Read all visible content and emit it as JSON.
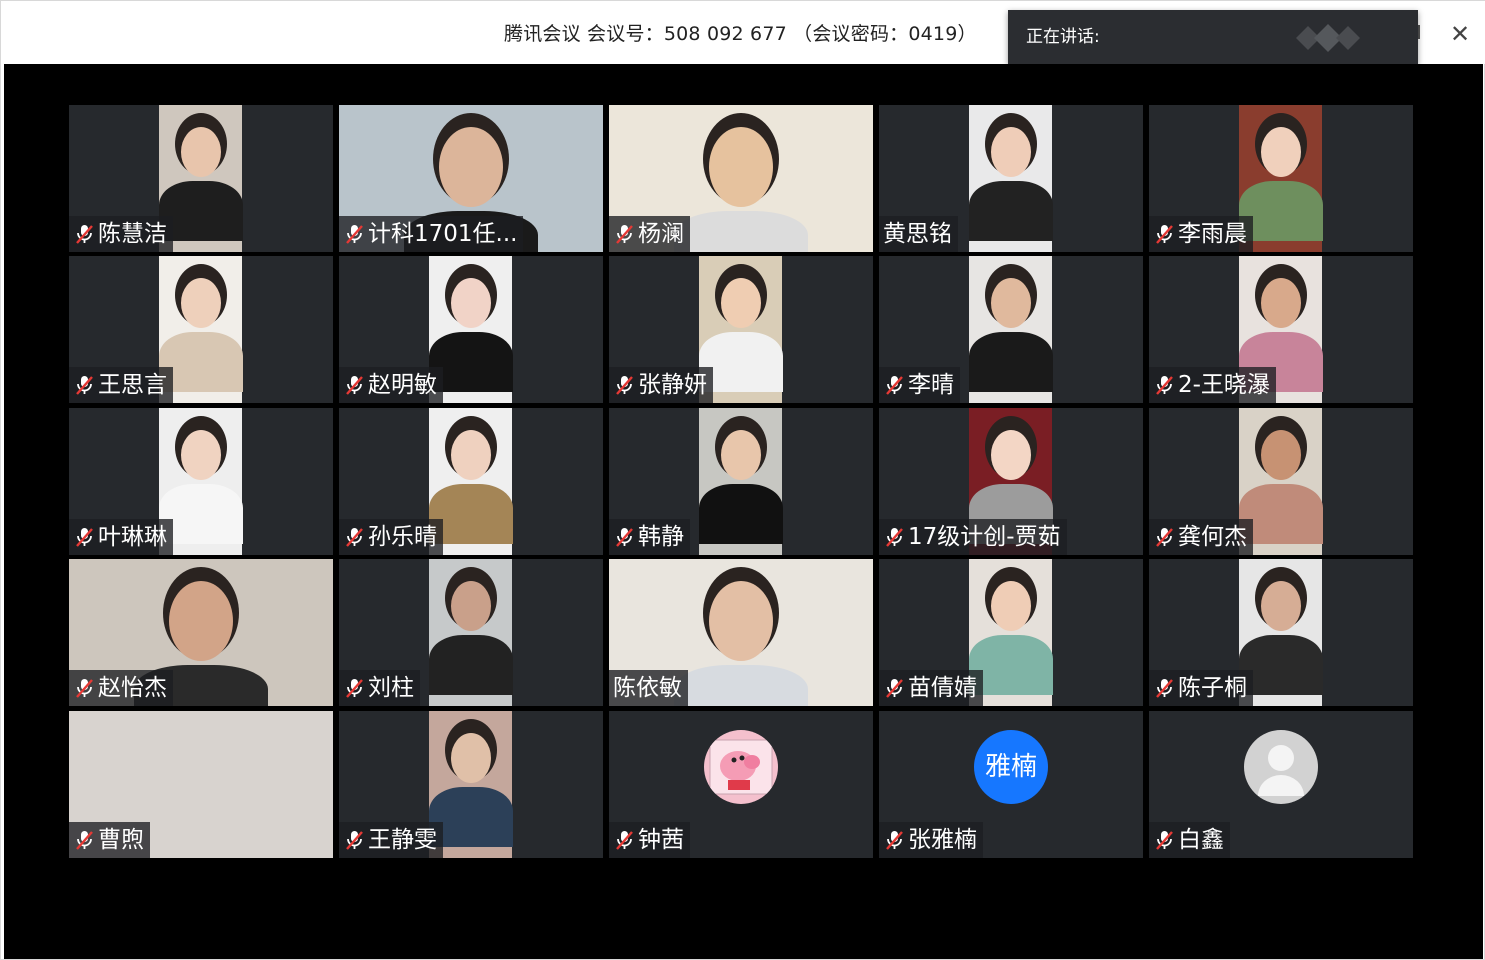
{
  "window": {
    "title": "腾讯会议  会议号：508 092 677 （会议密码：0419）",
    "close_icon": "close-icon",
    "maximize_icon": "maximize-icon"
  },
  "speaking_panel": {
    "label": "正在讲话:",
    "logo_icon": "tencent-meeting-logo-icon"
  },
  "colors": {
    "stage_bg": "#000000",
    "tile_bg": "#26292d",
    "avatar_blue": "#1677ff",
    "mic_muted_red": "#e53935"
  },
  "participants": [
    {
      "name": "陈慧洁",
      "muted": true,
      "tile": "video"
    },
    {
      "name": "计科1701任...",
      "muted": true,
      "tile": "video"
    },
    {
      "name": "杨澜",
      "muted": true,
      "tile": "video"
    },
    {
      "name": "黄思铭",
      "muted": false,
      "tile": "video"
    },
    {
      "name": "李雨晨",
      "muted": true,
      "tile": "video"
    },
    {
      "name": "王思言",
      "muted": true,
      "tile": "video"
    },
    {
      "name": "赵明敏",
      "muted": true,
      "tile": "video"
    },
    {
      "name": "张静妍",
      "muted": true,
      "tile": "video"
    },
    {
      "name": "李晴",
      "muted": true,
      "tile": "video"
    },
    {
      "name": "2-王晓瀑",
      "muted": true,
      "tile": "video"
    },
    {
      "name": "叶琳琳",
      "muted": true,
      "tile": "video"
    },
    {
      "name": "孙乐晴",
      "muted": true,
      "tile": "video"
    },
    {
      "name": "韩静",
      "muted": true,
      "tile": "video"
    },
    {
      "name": "17级计创-贾茹",
      "muted": true,
      "tile": "video"
    },
    {
      "name": "龚何杰",
      "muted": true,
      "tile": "video"
    },
    {
      "name": "赵怡杰",
      "muted": true,
      "tile": "video"
    },
    {
      "name": "刘柱",
      "muted": true,
      "tile": "video"
    },
    {
      "name": "陈依敏",
      "muted": false,
      "tile": "video"
    },
    {
      "name": "苗倩婧",
      "muted": true,
      "tile": "video"
    },
    {
      "name": "陈子桐",
      "muted": true,
      "tile": "video"
    },
    {
      "name": "曹煦",
      "muted": true,
      "tile": "video"
    },
    {
      "name": "王静雯",
      "muted": true,
      "tile": "video"
    },
    {
      "name": "钟茜",
      "muted": true,
      "tile": "avatar-pig"
    },
    {
      "name": "张雅楠",
      "muted": true,
      "tile": "avatar-text",
      "avatar_text": "雅楠"
    },
    {
      "name": "白鑫",
      "muted": true,
      "tile": "avatar-default"
    }
  ]
}
